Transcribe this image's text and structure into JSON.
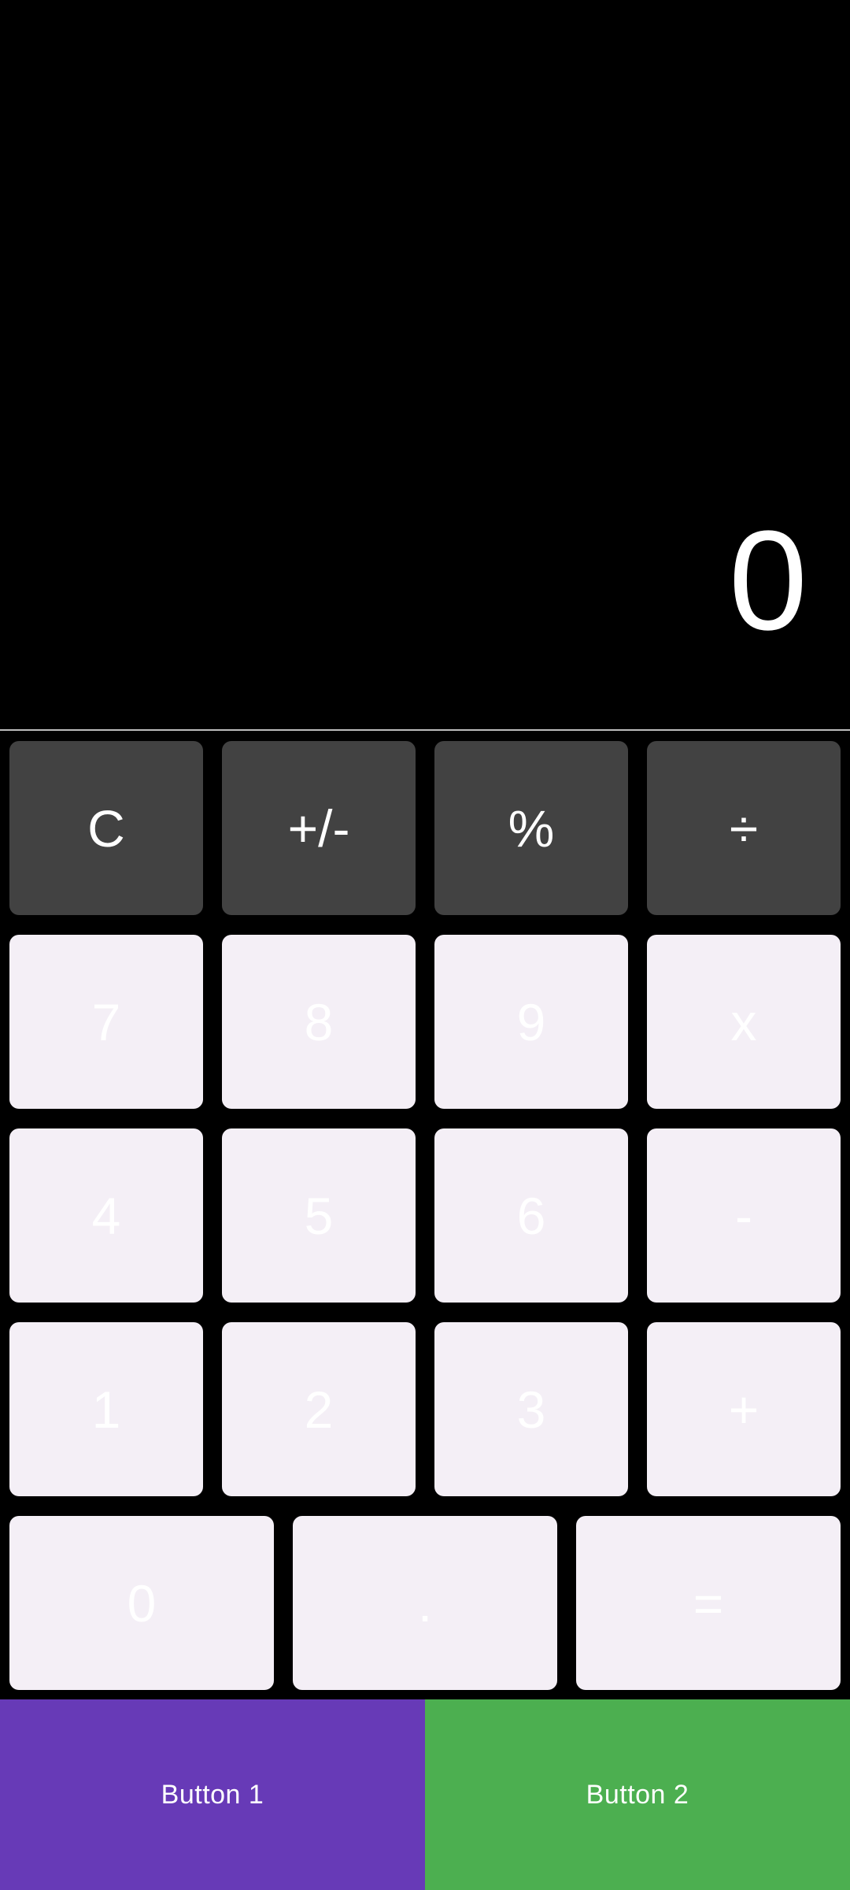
{
  "display": {
    "value": "0"
  },
  "keypad": {
    "row1": [
      "C",
      "+/-",
      "%",
      "÷"
    ],
    "row2": [
      "7",
      "8",
      "9",
      "x"
    ],
    "row3": [
      "4",
      "5",
      "6",
      "-"
    ],
    "row4": [
      "1",
      "2",
      "3",
      "+"
    ],
    "row5": [
      "0",
      ".",
      "="
    ]
  },
  "bottom": {
    "button1_label": "Button 1",
    "button2_label": "Button 2"
  },
  "colors": {
    "background": "#000000",
    "function_key": "#424242",
    "number_key": "#f4eff6",
    "button1": "#673ab7",
    "button2": "#4caf50"
  }
}
